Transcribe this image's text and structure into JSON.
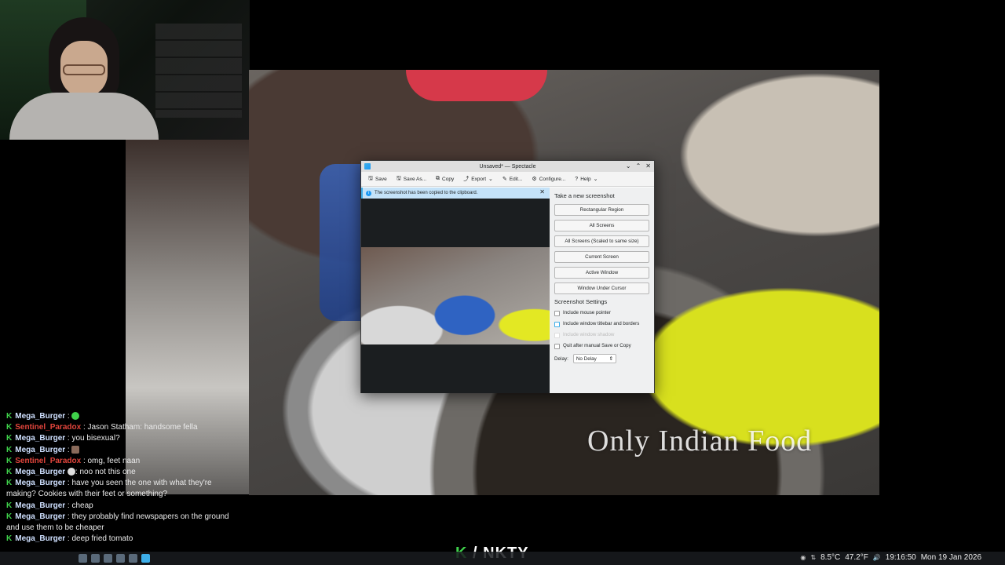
{
  "video": {
    "watermark": "Only Indian Food"
  },
  "spectacle": {
    "window_title": "Unsaved* — Spectacle",
    "toolbar": {
      "save": "Save",
      "save_as": "Save As...",
      "copy": "Copy",
      "export": "Export",
      "edit": "Edit...",
      "configure": "Configure...",
      "help": "Help"
    },
    "notice": "The screenshot has been copied to the clipboard.",
    "take_new_heading": "Take a new screenshot",
    "capture_modes": [
      "Rectangular Region",
      "All Screens",
      "All Screens (Scaled to same size)",
      "Current Screen",
      "Active Window",
      "Window Under Cursor"
    ],
    "settings_heading": "Screenshot Settings",
    "settings": {
      "include_pointer": "Include mouse pointer",
      "include_titlebar": "Include window titlebar and borders",
      "window_shadow": "Include window shadow",
      "quit_after": "Quit after manual Save or Copy"
    },
    "delay_label": "Delay:",
    "delay_value": "No Delay"
  },
  "chat": [
    {
      "user": "Mega_Burger",
      "text": ":"
    },
    {
      "user": "Sentinel_Paradox",
      "red": true,
      "text": ": Jason Statham: handsome fella"
    },
    {
      "user": "Mega_Burger",
      "text": ": you bisexual?"
    },
    {
      "user": "Mega_Burger",
      "text": ":"
    },
    {
      "user": "Sentinel_Paradox",
      "red": true,
      "text": ": omg, feet naan"
    },
    {
      "user": "Mega_Burger",
      "text": ": noo not this one"
    },
    {
      "user": "Mega_Burger",
      "text": ": have you seen the one with what they're making? Cookies with their feet or something?"
    },
    {
      "user": "Mega_Burger",
      "text": ": cheap"
    },
    {
      "user": "Mega_Burger",
      "text": ": they probably find newspapers on the ground and use them to be cheaper"
    },
    {
      "user": "Mega_Burger",
      "text": ": deep fried tomato"
    }
  ],
  "logo": {
    "k": "K",
    "rest": " / NKTY"
  },
  "taskbar": {
    "weather": "8.5°C",
    "temp_f": "47.2°F",
    "time": "19:16:50",
    "date": "Mon 19 Jan 2026"
  }
}
